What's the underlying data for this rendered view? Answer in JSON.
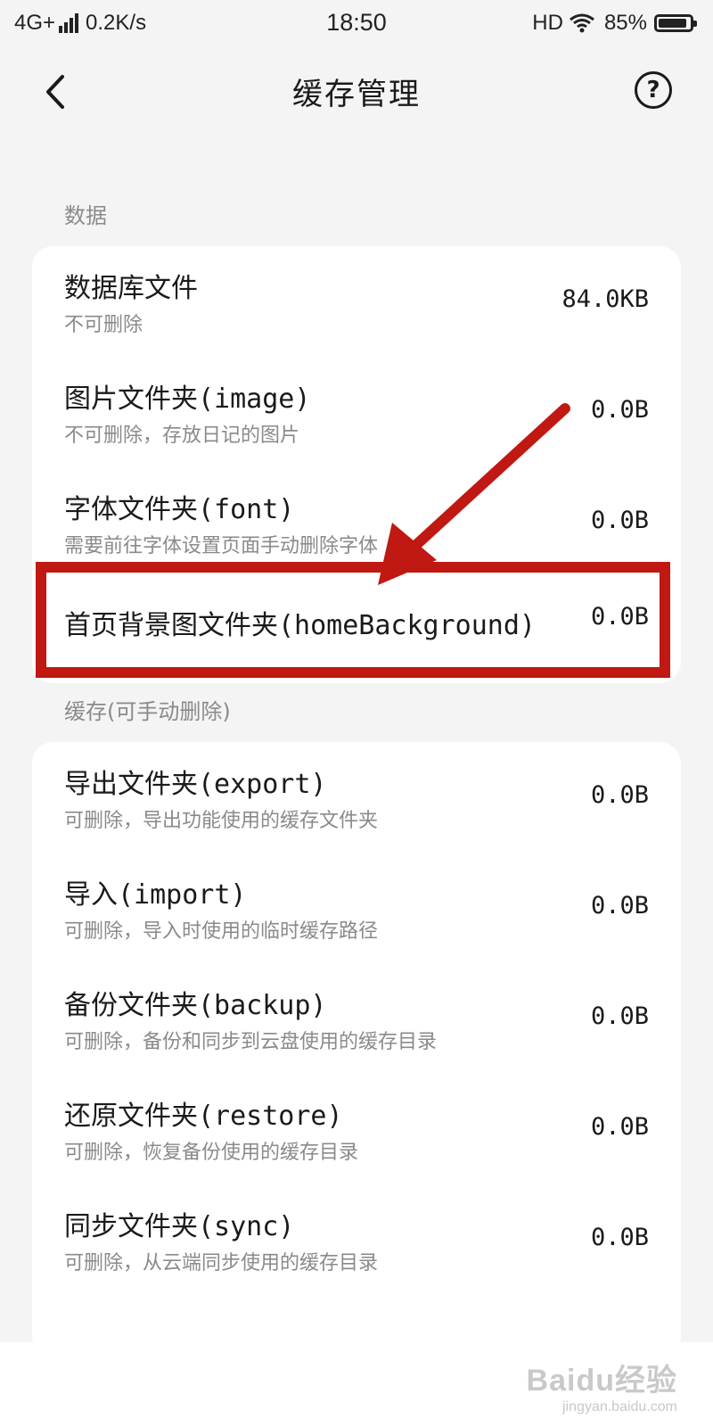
{
  "status_bar": {
    "network": "4G+",
    "speed": "0.2K/s",
    "time": "18:50",
    "hd": "HD",
    "battery": "85%"
  },
  "header": {
    "title": "缓存管理",
    "help_label": "?"
  },
  "sections": [
    {
      "label": "数据",
      "items": [
        {
          "title": "数据库文件",
          "subtitle": "不可删除",
          "size": "84.0KB"
        },
        {
          "title": "图片文件夹(image)",
          "subtitle": "不可删除，存放日记的图片",
          "size": "0.0B"
        },
        {
          "title": "字体文件夹(font)",
          "subtitle": "需要前往字体设置页面手动删除字体",
          "size": "0.0B"
        },
        {
          "title": "首页背景图文件夹(homeBackground)",
          "subtitle": "",
          "size": "0.0B"
        }
      ]
    },
    {
      "label": "缓存(可手动删除)",
      "items": [
        {
          "title": "导出文件夹(export)",
          "subtitle": "可删除，导出功能使用的缓存文件夹",
          "size": "0.0B"
        },
        {
          "title": "导入(import)",
          "subtitle": "可删除，导入时使用的临时缓存路径",
          "size": "0.0B"
        },
        {
          "title": "备份文件夹(backup)",
          "subtitle": "可删除，备份和同步到云盘使用的缓存目录",
          "size": "0.0B"
        },
        {
          "title": "还原文件夹(restore)",
          "subtitle": "可删除，恢复备份使用的缓存目录",
          "size": "0.0B"
        },
        {
          "title": "同步文件夹(sync)",
          "subtitle": "可删除，从云端同步使用的缓存目录",
          "size": "0.0B"
        }
      ]
    }
  ],
  "watermark": {
    "main": "Baidu经验",
    "sub": "jingyan.baidu.com"
  },
  "colors": {
    "annotation": "#c01812",
    "background": "#f4f4f4",
    "card": "#ffffff"
  }
}
